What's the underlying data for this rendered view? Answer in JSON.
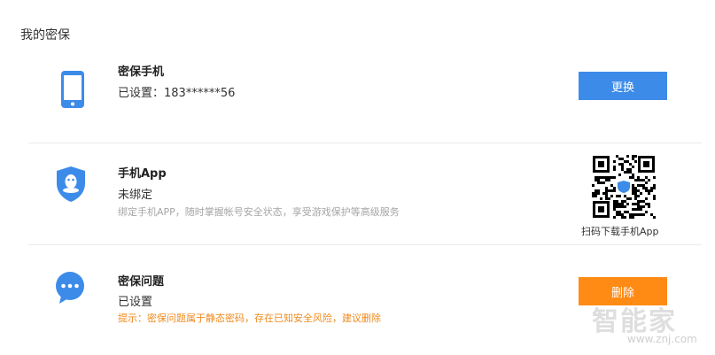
{
  "page": {
    "title": "我的密保"
  },
  "phone": {
    "title": "密保手机",
    "status": "已设置：183******56",
    "button_label": "更换",
    "icon": "phone-icon"
  },
  "app": {
    "title": "手机App",
    "status": "未绑定",
    "description": "绑定手机APP，随时掌握帐号安全状态，享受游戏保护等高级服务",
    "qr_caption": "扫码下载手机App",
    "icon": "qq-shield-icon"
  },
  "question": {
    "title": "密保问题",
    "status": "已设置",
    "warning": "提示：密保问题属于静态密码，存在已知安全风险，建议删除",
    "button_label": "删除",
    "icon": "chat-bubble-icon"
  },
  "watermark": {
    "text": "智能家",
    "url": "www.znj.com"
  },
  "colors": {
    "blue": "#3d8be9",
    "orange": "#ff8a14",
    "warn": "#f08a1c"
  }
}
